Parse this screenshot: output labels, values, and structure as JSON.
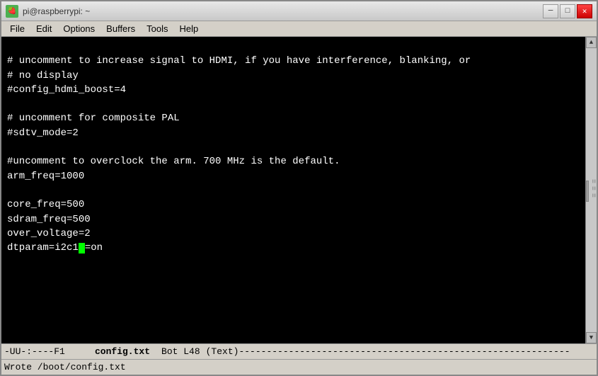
{
  "window": {
    "title": "pi@raspberrypi: ~",
    "icon": "🍓"
  },
  "titlebar": {
    "minimize_label": "─",
    "maximize_label": "□",
    "close_label": "✕"
  },
  "menubar": {
    "items": [
      "File",
      "Edit",
      "Options",
      "Buffers",
      "Tools",
      "Help"
    ]
  },
  "editor": {
    "lines": [
      "",
      "# uncomment to increase signal to HDMI, if you have interference, blanking, or",
      "# no display",
      "#config_hdmi_boost=4",
      "",
      "# uncomment for composite PAL",
      "#sdtv_mode=2",
      "",
      "#uncomment to overclock the arm. 700 MHz is the default.",
      "arm_freq=1000",
      "",
      "core_freq=500",
      "sdram_freq=500",
      "over_voltage=2",
      "dtparam=i2c1"
    ],
    "cursor_after": "dtparam=i2c1",
    "cursor_rest": "=on"
  },
  "statusbar": {
    "mode": "-UU-:----F1",
    "filename": "config.txt",
    "position": "Bot L48",
    "type": "(Text)",
    "dashes": "------------------------------------------------------------"
  },
  "bottombar": {
    "message": "Wrote /boot/config.txt"
  }
}
